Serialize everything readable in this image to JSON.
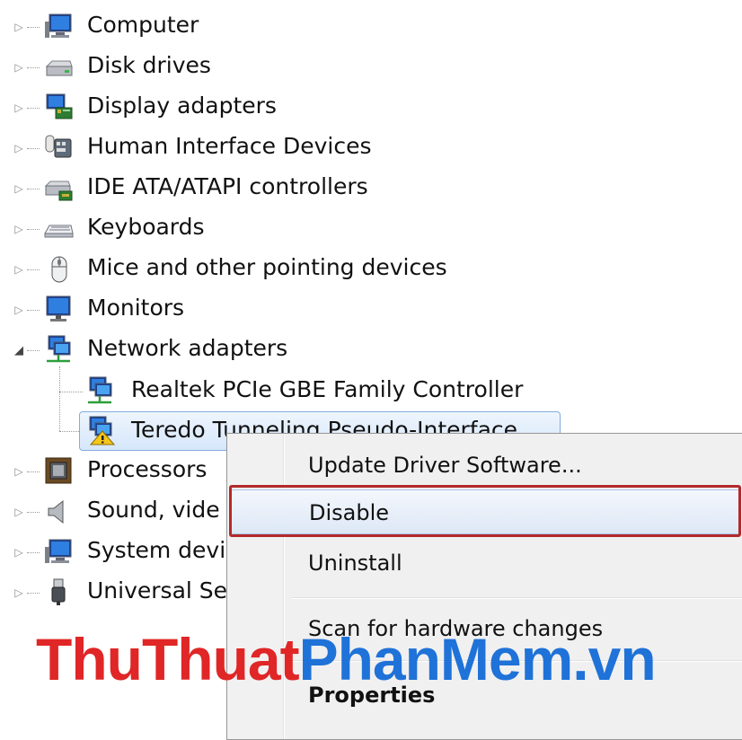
{
  "tree": {
    "items": [
      {
        "label": "Computer",
        "icon": "computer-icon",
        "expanded": false
      },
      {
        "label": "Disk drives",
        "icon": "disk-drive-icon",
        "expanded": false
      },
      {
        "label": "Display adapters",
        "icon": "display-adapter-icon",
        "expanded": false
      },
      {
        "label": "Human Interface Devices",
        "icon": "hid-icon",
        "expanded": false
      },
      {
        "label": "IDE ATA/ATAPI controllers",
        "icon": "ide-controller-icon",
        "expanded": false
      },
      {
        "label": "Keyboards",
        "icon": "keyboard-icon",
        "expanded": false
      },
      {
        "label": "Mice and other pointing devices",
        "icon": "mouse-icon",
        "expanded": false
      },
      {
        "label": "Monitors",
        "icon": "monitor-icon",
        "expanded": false
      },
      {
        "label": "Network adapters",
        "icon": "network-adapter-icon",
        "expanded": true
      },
      {
        "label": "Processors",
        "icon": "processor-icon",
        "expanded": false
      },
      {
        "label": "Sound, vide",
        "icon": "speaker-icon",
        "expanded": false
      },
      {
        "label": "System devi",
        "icon": "system-device-icon",
        "expanded": false
      },
      {
        "label": "Universal Se",
        "icon": "usb-icon",
        "expanded": false
      }
    ],
    "children": [
      {
        "label": "Realtek PCIe GBE Family Controller",
        "icon": "network-adapter-icon"
      },
      {
        "label": "Teredo Tunneling Pseudo-Interface",
        "icon": "network-adapter-warning-icon",
        "selected": true
      }
    ]
  },
  "context_menu": {
    "items": [
      {
        "label": "Update Driver Software..."
      },
      {
        "label": "Disable",
        "highlighted": true
      },
      {
        "label": "Uninstall"
      },
      {
        "label": "Scan for hardware changes"
      },
      {
        "label": "Properties",
        "bold": true
      }
    ]
  },
  "watermark": {
    "part1": "ThuThuat",
    "part2": "PhanMem.vn"
  },
  "colors": {
    "highlight_box": "#b32a2a",
    "selection": "#d6e7fb",
    "watermark_red": "#e02626",
    "watermark_blue": "#1f72d8"
  }
}
